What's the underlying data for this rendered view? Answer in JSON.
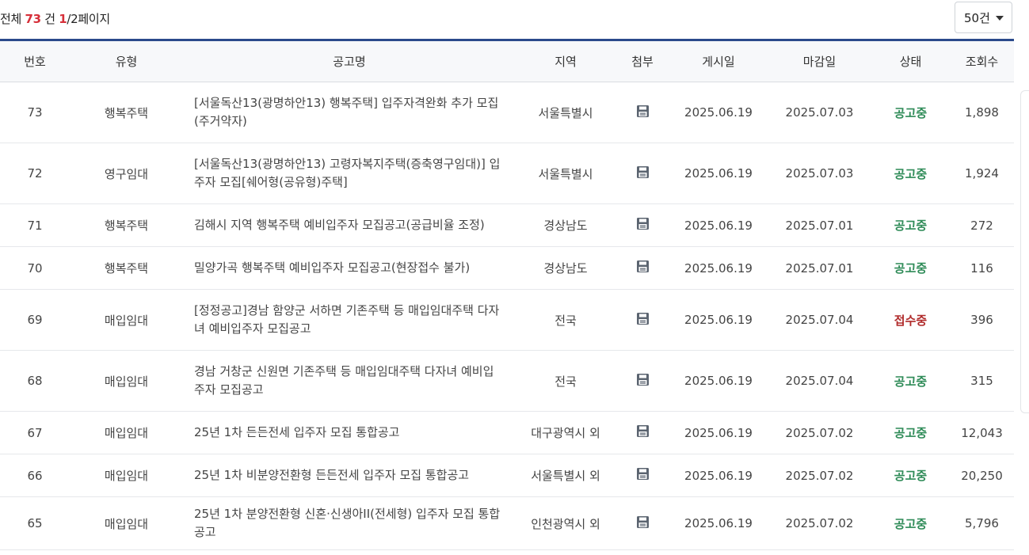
{
  "summary": {
    "prefix": "전체",
    "total": "73",
    "total_unit": "건",
    "page_current": "1",
    "page_rest": "/2페이지"
  },
  "page_size": {
    "selected": "50건"
  },
  "columns": [
    "번호",
    "유형",
    "공고명",
    "지역",
    "첨부",
    "게시일",
    "마감일",
    "상태",
    "조회수"
  ],
  "rows": [
    {
      "no": "73",
      "type": "행복주택",
      "title": "[서울독산13(광명하안13) 행복주택] 입주자격완화 추가 모집(주거약자)",
      "region": "서울특별시",
      "posted": "2025.06.19",
      "deadline": "2025.07.03",
      "status": "공고중",
      "views": "1,898"
    },
    {
      "no": "72",
      "type": "영구임대",
      "title": "[서울독산13(광명하안13) 고령자복지주택(증축영구임대)] 입주자 모집[쉐어형(공유형)주택]",
      "region": "서울특별시",
      "posted": "2025.06.19",
      "deadline": "2025.07.03",
      "status": "공고중",
      "views": "1,924"
    },
    {
      "no": "71",
      "type": "행복주택",
      "title": "김해시 지역 행복주택 예비입주자 모집공고(공급비율 조정)",
      "region": "경상남도",
      "posted": "2025.06.19",
      "deadline": "2025.07.01",
      "status": "공고중",
      "views": "272"
    },
    {
      "no": "70",
      "type": "행복주택",
      "title": "밀양가곡 행복주택 예비입주자 모집공고(현장접수 불가)",
      "region": "경상남도",
      "posted": "2025.06.19",
      "deadline": "2025.07.01",
      "status": "공고중",
      "views": "116"
    },
    {
      "no": "69",
      "type": "매입임대",
      "title": "[정정공고]경남 함양군 서하면 기존주택 등 매입임대주택 다자녀 예비입주자 모집공고",
      "region": "전국",
      "posted": "2025.06.19",
      "deadline": "2025.07.04",
      "status": "접수중",
      "views": "396"
    },
    {
      "no": "68",
      "type": "매입임대",
      "title": "경남 거창군 신원면 기존주택 등 매입임대주택 다자녀 예비입주자 모집공고",
      "region": "전국",
      "posted": "2025.06.19",
      "deadline": "2025.07.04",
      "status": "공고중",
      "views": "315"
    },
    {
      "no": "67",
      "type": "매입임대",
      "title": "25년 1차 든든전세 입주자 모집 통합공고",
      "region": "대구광역시 외",
      "posted": "2025.06.19",
      "deadline": "2025.07.02",
      "status": "공고중",
      "views": "12,043"
    },
    {
      "no": "66",
      "type": "매입임대",
      "title": "25년 1차 비분양전환형 든든전세 입주자 모집 통합공고",
      "region": "서울특별시 외",
      "posted": "2025.06.19",
      "deadline": "2025.07.02",
      "status": "공고중",
      "views": "20,250"
    },
    {
      "no": "65",
      "type": "매입임대",
      "title": "25년 1차 분양전환형 신혼·신생아ⅠⅠ(전세형) 입주자 모집 통합공고",
      "region": "인천광역시 외",
      "posted": "2025.06.19",
      "deadline": "2025.07.02",
      "status": "공고중",
      "views": "5,796"
    }
  ],
  "attachment_icon": "save-file-icon",
  "status_colors": {
    "공고중": "#2e8b57",
    "접수중": "#b02a2a"
  },
  "accent_color": "#2b4a8b"
}
